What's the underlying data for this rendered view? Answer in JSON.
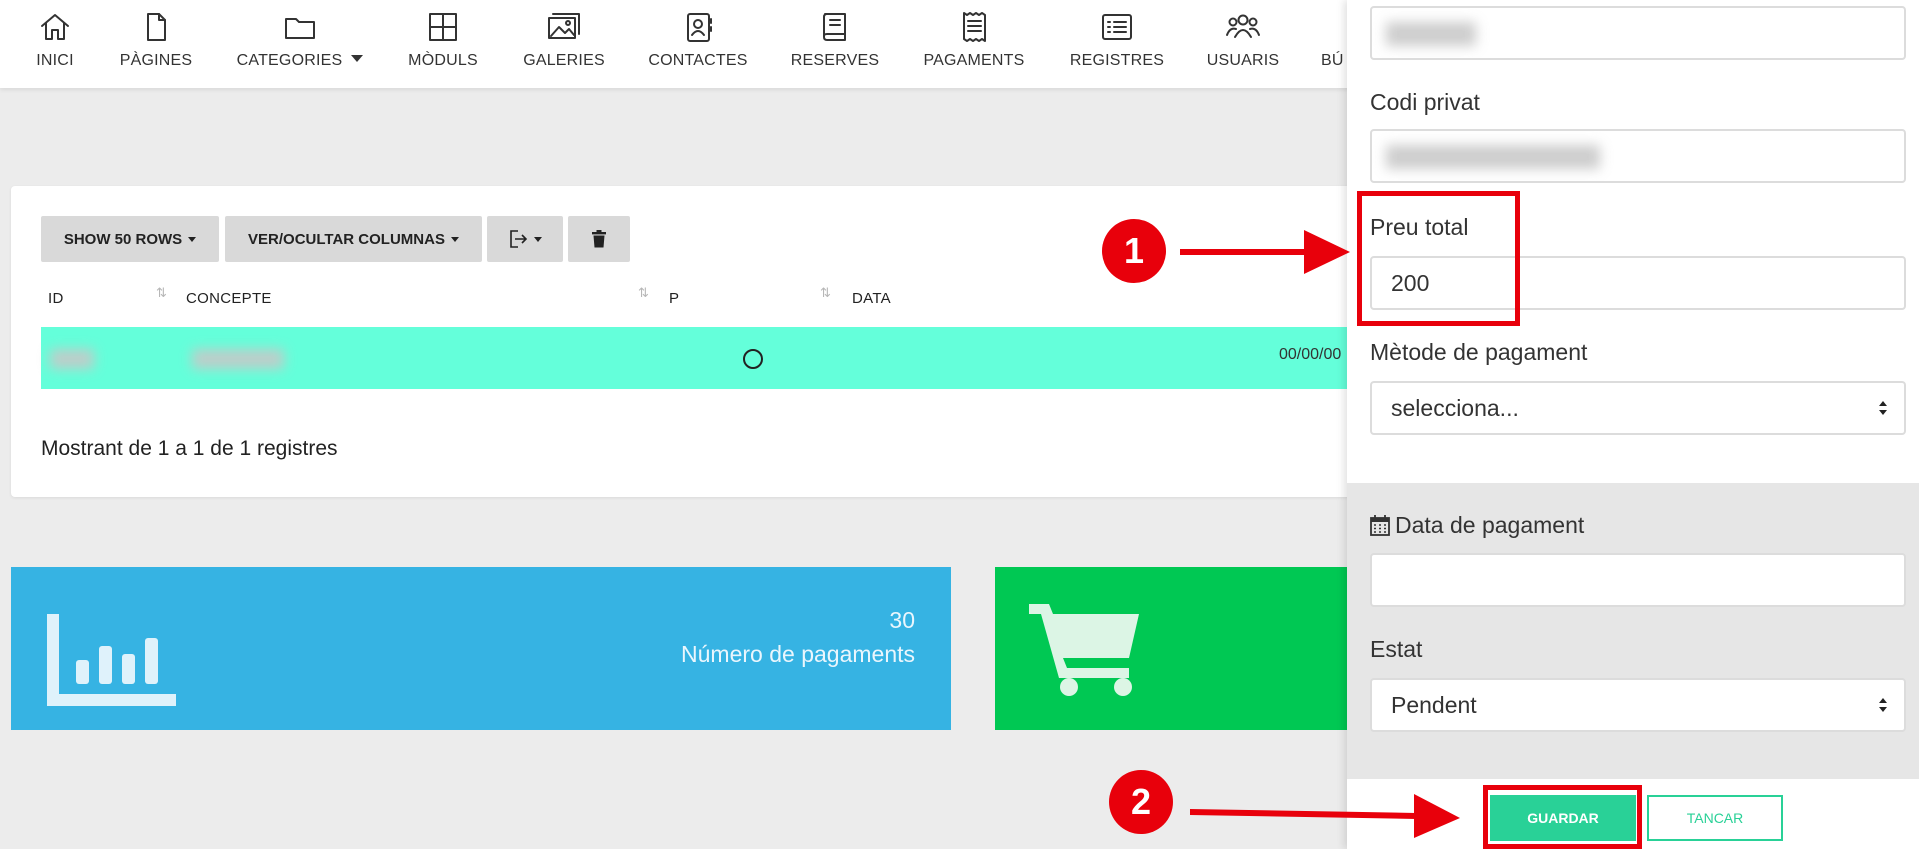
{
  "nav": {
    "items": [
      {
        "label": "INICI",
        "icon": "home-icon"
      },
      {
        "label": "PÀGINES",
        "icon": "file-icon"
      },
      {
        "label": "CATEGORIES",
        "icon": "folder-icon"
      },
      {
        "label": "MÒDULS",
        "icon": "grid-icon"
      },
      {
        "label": "GALERIES",
        "icon": "images-icon"
      },
      {
        "label": "CONTACTES",
        "icon": "contacts-icon"
      },
      {
        "label": "RESERVES",
        "icon": "book-icon"
      },
      {
        "label": "PAGAMENTS",
        "icon": "receipt-icon"
      },
      {
        "label": "REGISTRES",
        "icon": "list-icon"
      },
      {
        "label": "USUARIS",
        "icon": "users-icon"
      },
      {
        "label": "BÚ",
        "icon": "search-icon"
      }
    ]
  },
  "table": {
    "buttons": {
      "rows": "SHOW 50 ROWS",
      "columns": "VER/OCULTAR COLUMNAS"
    },
    "headers": {
      "id": "ID",
      "concept": "CONCEPTE",
      "p": "P",
      "date": "DATA"
    },
    "row": {
      "date": "00/00/00"
    },
    "info": "Mostrant de 1 a 1 de 1 registres"
  },
  "stats": {
    "payments": {
      "value": "30",
      "label": "Número de pagaments"
    }
  },
  "panel": {
    "private_code_label": "Codi privat",
    "total_price_label": "Preu total",
    "total_price_value": "200",
    "payment_method_label": "Mètode de pagament",
    "payment_method_value": "selecciona...",
    "payment_date_label": "Data de pagament",
    "payment_date_value": "",
    "status_label": "Estat",
    "status_value": "Pendent",
    "save_label": "GUARDAR",
    "cancel_label": "TANCAR"
  },
  "annotations": {
    "step1": "1",
    "step2": "2"
  },
  "colors": {
    "row_highlight": "#64ffda",
    "stat_blue": "#36b3e3",
    "stat_green": "#00c853",
    "accent": "#29d197",
    "annotation_red": "#e8000b"
  }
}
